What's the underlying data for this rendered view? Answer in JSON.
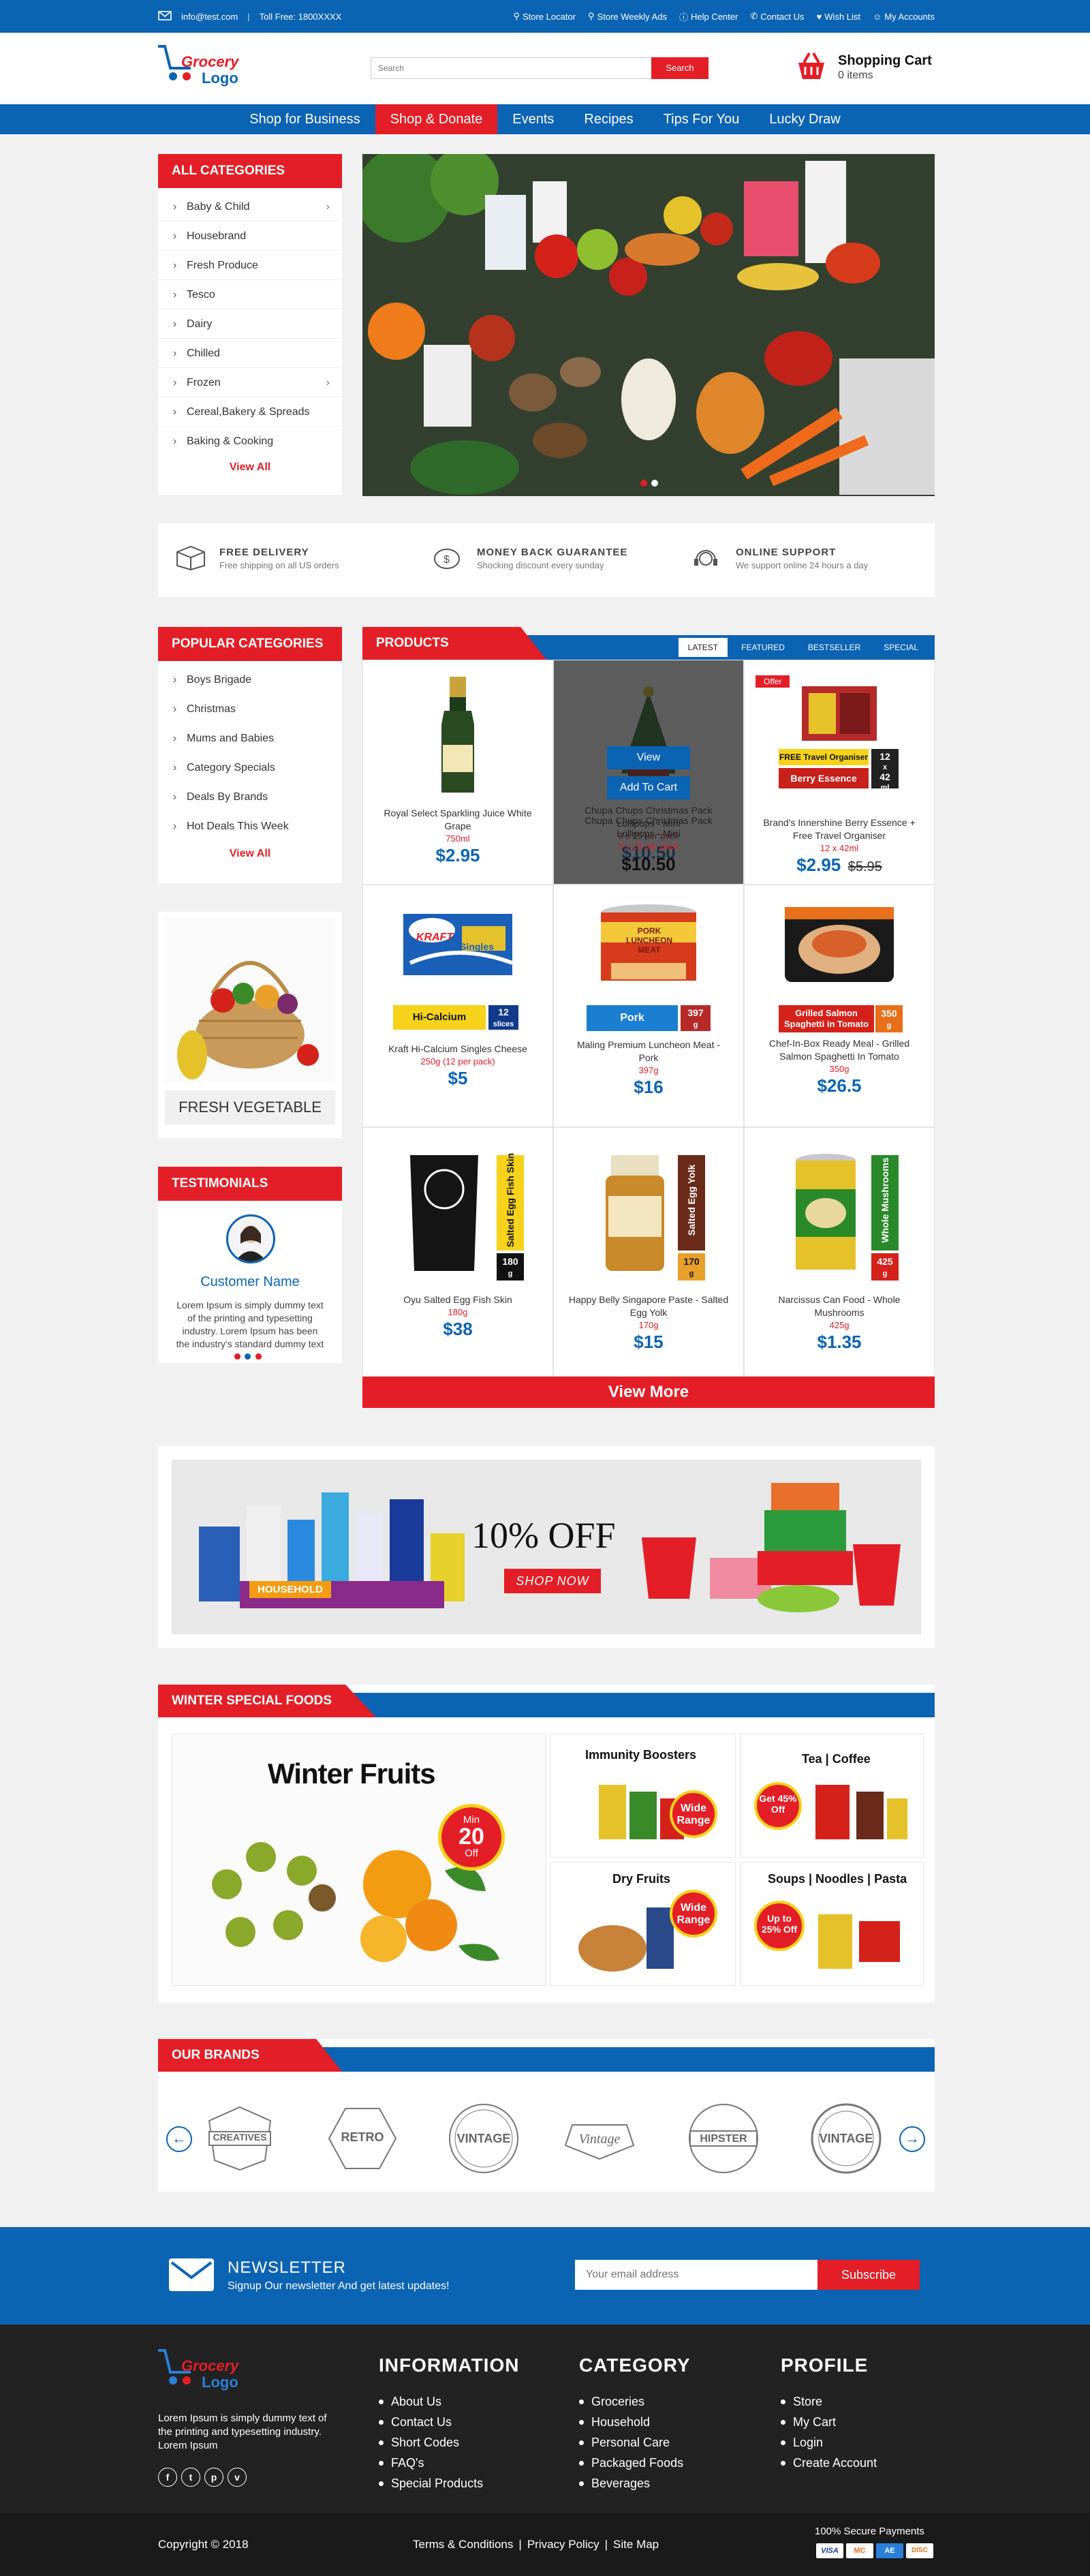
{
  "topbar": {
    "email": "info@test.com",
    "tollfree": "Toll Free: 1800XXXX",
    "links": [
      "Store Locator",
      "Store Weekly Ads",
      "Help Center",
      "Contact Us",
      "Wish List",
      "My Accounts"
    ]
  },
  "logo": {
    "line1": "Grocery",
    "line2": "Logo"
  },
  "search": {
    "placeholder": "Search",
    "button": "Search"
  },
  "cart": {
    "title": "Shopping Cart",
    "items": "0 items"
  },
  "nav": [
    "Shop for Business",
    "Shop & Donate",
    "Events",
    "Recipes",
    "Tips For You",
    "Lucky Draw"
  ],
  "categories": {
    "title": "ALL CATEGORIES",
    "items": [
      "Baby & Child",
      "Housebrand",
      "Fresh Produce",
      "Tesco",
      "Dairy",
      "Chilled",
      "Frozen",
      "Cereal,Bakery & Spreads",
      "Baking & Cooking"
    ],
    "view_all": "View All"
  },
  "features": [
    {
      "title": "FREE DELIVERY",
      "sub": "Free shipping on all US orders"
    },
    {
      "title": "MONEY BACK GUARANTEE",
      "sub": "Shocking discount every sunday"
    },
    {
      "title": "ONLINE SUPPORT",
      "sub": "We support online 24 hours a day"
    }
  ],
  "popular": {
    "title": "POPULAR CATEGORIES",
    "items": [
      "Boys Brigade",
      "Christmas",
      "Mums and Babies",
      "Category Specials",
      "Deals By Brands",
      "Hot Deals This Week"
    ],
    "view_all": "View All"
  },
  "fresh_veg": "FRESH VEGETABLE",
  "testimonials": {
    "title": "TESTIMONIALS",
    "name": "Customer Name",
    "text": "Lorem Ipsum is simply dummy text of the printing and typesetting industry. Lorem Ipsum has been the industry's standard dummy text ever since the"
  },
  "products": {
    "title": "PRODUCTS",
    "tabs": [
      "LATEST",
      "FEATURED",
      "BESTSELLER",
      "SPECIAL"
    ],
    "view_label": "View",
    "add_label": "Add To Cart",
    "offer": "Offer",
    "items": [
      {
        "name": "Royal Select Sparkling Juice White Grape",
        "qty": "750ml",
        "price": "$2.95",
        "old": ""
      },
      {
        "name": "Chupa Chups Christmas Pack Lollipops - Mini",
        "qty": "3 x 25 per pack",
        "price": "$10.50",
        "old": ""
      },
      {
        "name": "Brand's Innershine Berry Essence + Free Travel Organiser",
        "qty": "12 x 42ml",
        "price": "$2.95",
        "old": "$5.95"
      },
      {
        "name": "Kraft Hi-Calcium Singles Cheese",
        "qty": "250g (12 per pack)",
        "price": "$5",
        "old": ""
      },
      {
        "name": "Maling Premium Luncheon Meat - Pork",
        "qty": "397g",
        "price": "$16",
        "old": ""
      },
      {
        "name": "Chef-In-Box Ready Meal - Grilled Salmon Spaghetti In Tomato",
        "qty": "350g",
        "price": "$26.5",
        "old": ""
      },
      {
        "name": "Oyu Salted Egg Fish Skin",
        "qty": "180g",
        "price": "$38",
        "old": ""
      },
      {
        "name": "Happy Belly Singapore Paste - Salted Egg Yolk",
        "qty": "170g",
        "price": "$15",
        "old": ""
      },
      {
        "name": "Narcissus Can Food - Whole Mushrooms",
        "qty": "425g",
        "price": "$1.35",
        "old": ""
      }
    ],
    "view_more": "View More"
  },
  "product_tags": {
    "brands_a": "FREE Travel Organiser",
    "brands_b": "Berry Essence",
    "brands_n1": "12",
    "brands_u1": "x",
    "brands_n2": "42",
    "brands_u2": "ml",
    "kraft_a": "Hi-Calcium",
    "kraft_n": "12",
    "kraft_u": "slices",
    "kraft_brand": "KRAFT",
    "kraft_prod": "Singles",
    "pork_a": "Pork",
    "pork_n": "397",
    "pork_u": "g",
    "pork_can": "PORK LUNCHEON MEAT",
    "salmon_a": "Grilled Salmon Spaghetti in Tomato",
    "salmon_n": "350",
    "salmon_u": "g",
    "oyu_a": "Salted Egg Fish Skin",
    "oyu_n": "180",
    "oyu_u": "g",
    "belly_a": "Salted Egg Yolk",
    "belly_n": "170",
    "belly_u": "g",
    "mush_a": "Whole Mushrooms",
    "mush_n": "425",
    "mush_u": "g"
  },
  "promo": {
    "discount": "10% OFF",
    "cta": "SHOP NOW",
    "tag": "HOUSEHOLD"
  },
  "winter": {
    "title": "WINTER SPECIAL FOODS",
    "main": "Winter Fruits",
    "min": "Min",
    "pct": "20",
    "off": "Off",
    "tiles": [
      {
        "title": "Immunity Boosters",
        "badge": "Wide Range"
      },
      {
        "title": "Tea | Coffee",
        "badge": "Get 45% Off"
      },
      {
        "title": "Dry Fruits",
        "badge": "Wide Range"
      },
      {
        "title": "Soups | Noodles | Pasta",
        "badge": "Up to 25% Off"
      }
    ]
  },
  "brands": {
    "title": "OUR BRANDS",
    "items": [
      "CREATIVES",
      "RETRO",
      "VINTAGE",
      "Vintage",
      "HIPSTER",
      "VINTAGE"
    ]
  },
  "newsletter": {
    "title": "NEWSLETTER",
    "sub": "Signup Our newsletter And get latest updates!",
    "placeholder": "Your email address",
    "button": "Subscribe"
  },
  "footer": {
    "about": "Lorem Ipsum is simply dummy text of the printing and typesetting industry. Lorem Ipsum",
    "info_title": "INFORMATION",
    "info": [
      "About Us",
      "Contact Us",
      "Short Codes",
      "FAQ's",
      "Special Products"
    ],
    "cat_title": "CATEGORY",
    "cat": [
      "Groceries",
      "Household",
      "Personal Care",
      "Packaged Foods",
      "Beverages"
    ],
    "prof_title": "PROFILE",
    "prof": [
      "Store",
      "My Cart",
      "Login",
      "Create Account"
    ],
    "social": [
      "f",
      "t",
      "p",
      "v"
    ]
  },
  "copyright": {
    "text": "Copyright © 2018",
    "links": [
      "Terms & Conditions",
      "Privacy Policy",
      "Site Map"
    ],
    "secure": "100% Secure Payments",
    "cards": [
      "VISA",
      "MC",
      "AE",
      "DISC"
    ]
  },
  "colors": {
    "primary": "#0b63b3",
    "accent": "#e41e26"
  }
}
